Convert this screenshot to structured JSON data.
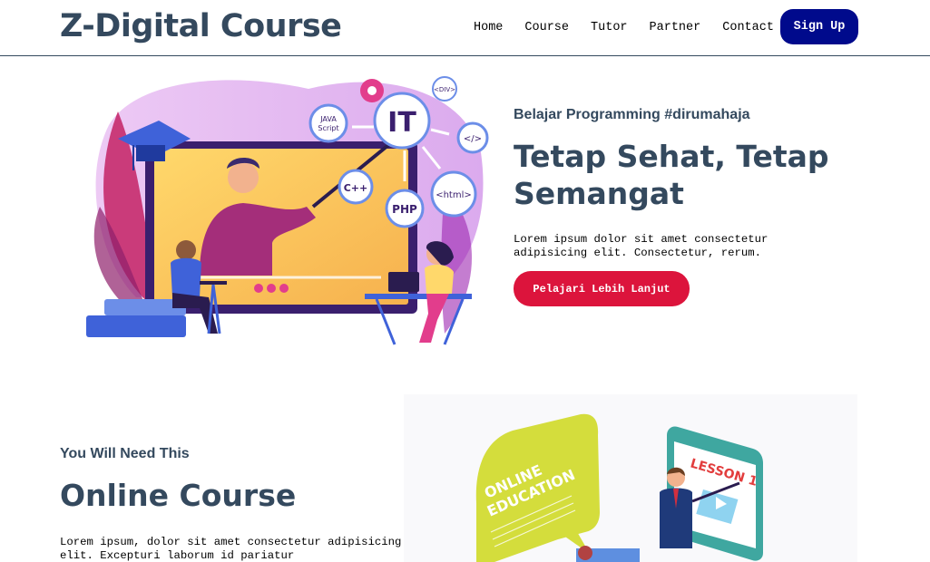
{
  "navbar": {
    "brand": "Z-Digital Course",
    "links": [
      "Home",
      "Course",
      "Tutor",
      "Partner",
      "Contact"
    ],
    "signup_label": "Sign Up"
  },
  "hero": {
    "eyebrow": "Belajar Programming #dirumahaja",
    "title": "Tetap Sehat, Tetap Semangat",
    "description": "Lorem ipsum dolor sit amet consectetur adipisicing elit. Consectetur, rerum.",
    "cta_label": "Pelajari Lebih Lanjut",
    "illustration": {
      "badges": [
        "IT",
        "JAVA",
        "Script",
        "C++",
        "PHP",
        "<html>",
        "</>",
        "<DIV>"
      ]
    }
  },
  "section_online": {
    "eyebrow": "You Will Need This",
    "title": "Online Course",
    "description": "Lorem ipsum, dolor sit amet consectetur adipisicing elit. Excepturi laborum id pariatur",
    "illustration": {
      "bubble_line1": "ONLINE",
      "bubble_line2": "EDUCATION",
      "board_text": "LESSON 1"
    }
  },
  "colors": {
    "primary_text": "#34495e",
    "signup_bg": "#000a8c",
    "cta_bg": "#dc143c"
  }
}
